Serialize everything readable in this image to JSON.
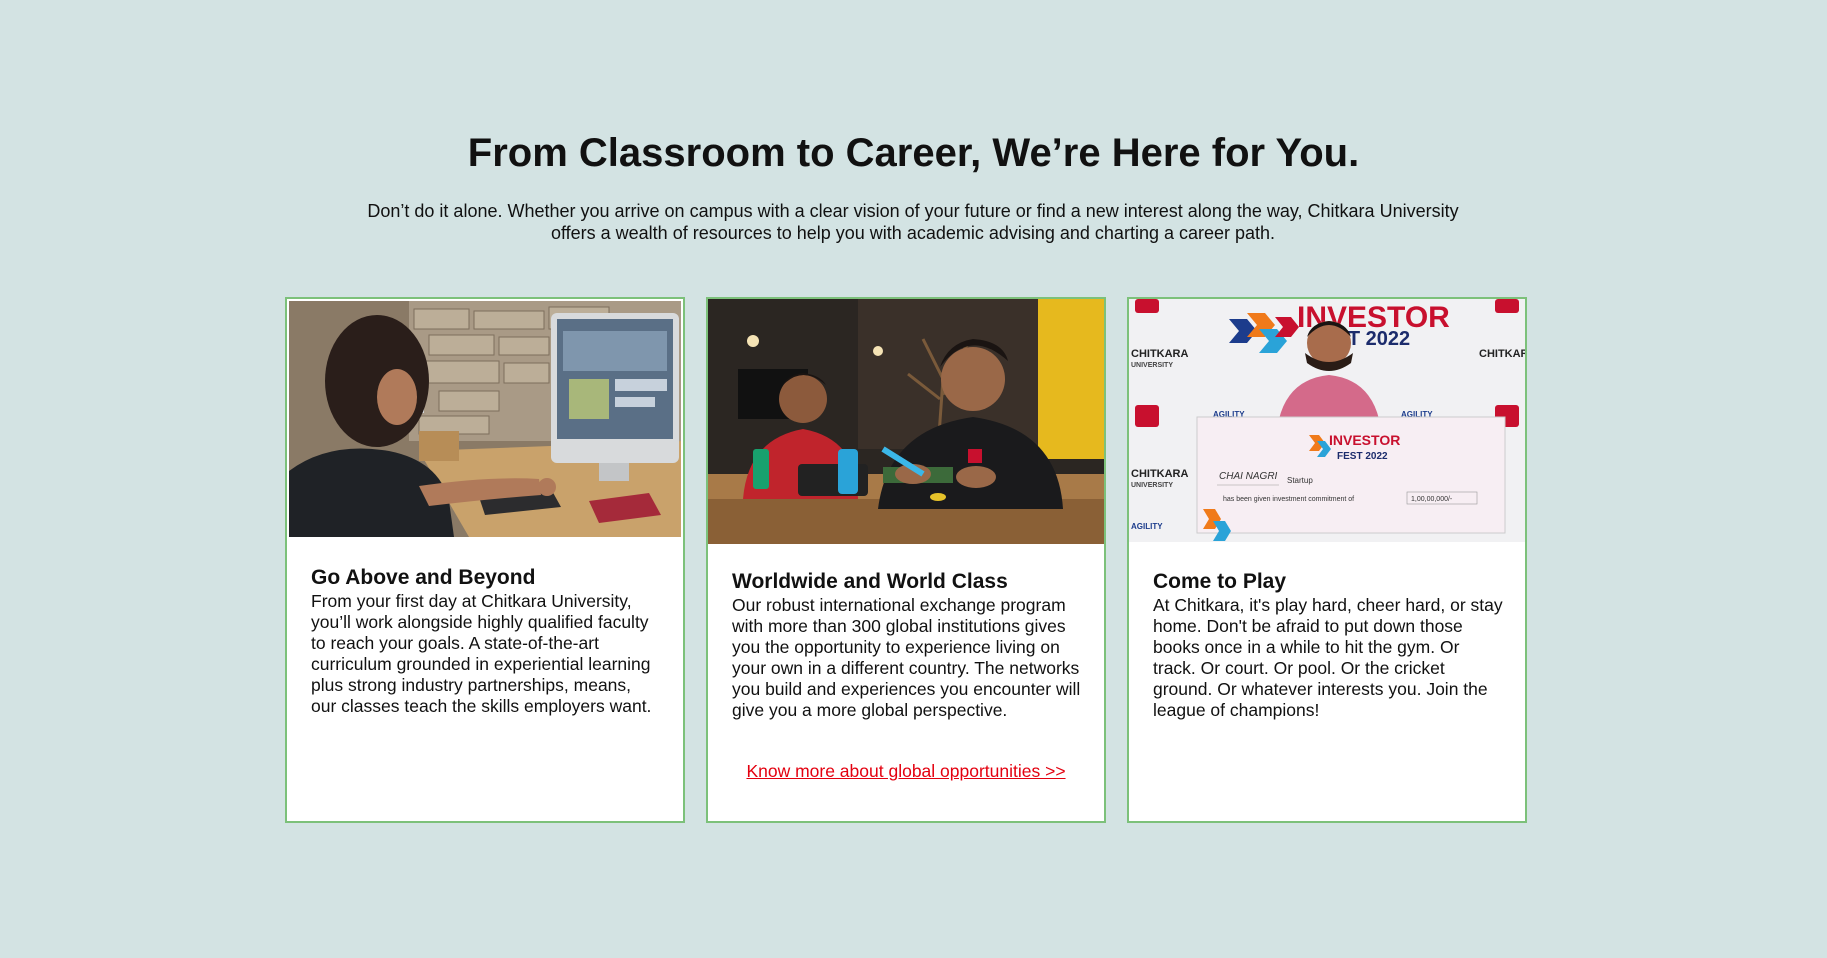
{
  "section": {
    "heading": "From Classroom to Career, We’re Here for You.",
    "intro": "Don’t do it alone. Whether you arrive on campus with a clear vision of your future or find a new interest along the way, Chitkara University offers a wealth of resources to help you with academic advising and charting a career path."
  },
  "cards": [
    {
      "title": "Go Above and Beyond",
      "text": "From your first day at Chitkara University, you’ll work alongside highly qualified faculty to reach your goals. A state-of-the-art curriculum grounded in experiential learning plus strong industry partnerships, means, our classes teach the skills employers want."
    },
    {
      "title": "Worldwide and World Class",
      "text": "Our robust international exchange program with more than 300 global institutions gives you the opportunity to experience living on your own in a different country. The networks you build and experiences you encounter will give you a more global perspective.",
      "link": "Know more about global opportunities >>"
    },
    {
      "title": "Come to Play",
      "text": "At Chitkara, it's play hard, cheer hard, or stay home. Don't be afraid to put down those books once in a while to hit the gym. Or track. Or court. Or pool. Or the cricket ground. Or whatever interests you. Join the league of champions!"
    }
  ],
  "photo_text": {
    "banner_title": "INVESTOR",
    "banner_sub": "FEST 2022",
    "brand": "CHITKARA",
    "brand_sub": "UNIVERSITY",
    "partner": "AGILITY",
    "cheque_title": "INVESTOR",
    "cheque_sub": "FEST 2022",
    "cheque_name": "CHAI NAGRI",
    "cheque_label": "Startup",
    "cheque_line": "has been given investment commitment of",
    "cheque_amount": "1,00,00,000/-"
  },
  "colors": {
    "background": "#d3e3e3",
    "card_border": "#7cc17a",
    "link": "#e3000f",
    "brand_red": "#c8102e"
  }
}
